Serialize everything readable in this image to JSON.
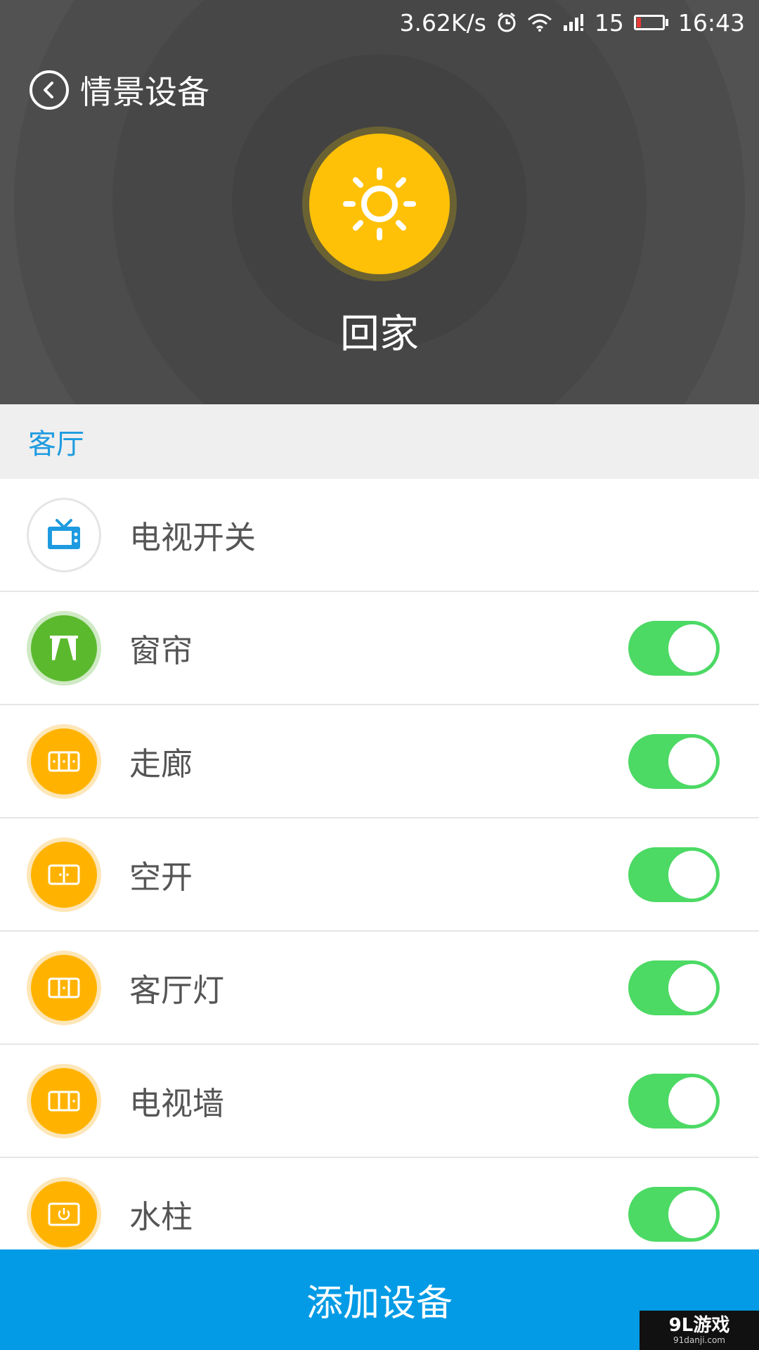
{
  "status_bar": {
    "network_speed": "3.62K/s",
    "battery_level": "15",
    "time": "16:43",
    "icons": [
      "alarm-icon",
      "wifi-icon",
      "signal-icon",
      "battery-icon"
    ]
  },
  "header": {
    "title": "情景设备",
    "back_icon": "back-arrow-icon",
    "scene_icon": "sun-icon",
    "scene_name": "回家",
    "colors": {
      "background": "#525252",
      "scene_accent": "#ffc107"
    }
  },
  "section": {
    "title": "客厅",
    "color": "#1e9be0"
  },
  "devices": [
    {
      "label": "电视开关",
      "icon": "tv-icon",
      "style": "tv",
      "has_toggle": false
    },
    {
      "label": "窗帘",
      "icon": "curtain-icon",
      "style": "green",
      "has_toggle": true,
      "on": true
    },
    {
      "label": "走廊",
      "icon": "switch-panel-icon",
      "style": "orange",
      "has_toggle": true,
      "on": true
    },
    {
      "label": "空开",
      "icon": "switch-panel-icon",
      "style": "orange",
      "has_toggle": true,
      "on": true
    },
    {
      "label": "客厅灯",
      "icon": "switch-panel-icon",
      "style": "orange",
      "has_toggle": true,
      "on": true
    },
    {
      "label": "电视墙",
      "icon": "switch-panel-icon",
      "style": "orange",
      "has_toggle": true,
      "on": true
    },
    {
      "label": "水柱",
      "icon": "power-socket-icon",
      "style": "orange",
      "has_toggle": true,
      "on": true
    }
  ],
  "toggle_color": "#4cd964",
  "footer": {
    "add_device_label": "添加设备",
    "color": "#039be5"
  },
  "watermark": {
    "main": "9L游戏",
    "sub": "91danji.com"
  }
}
